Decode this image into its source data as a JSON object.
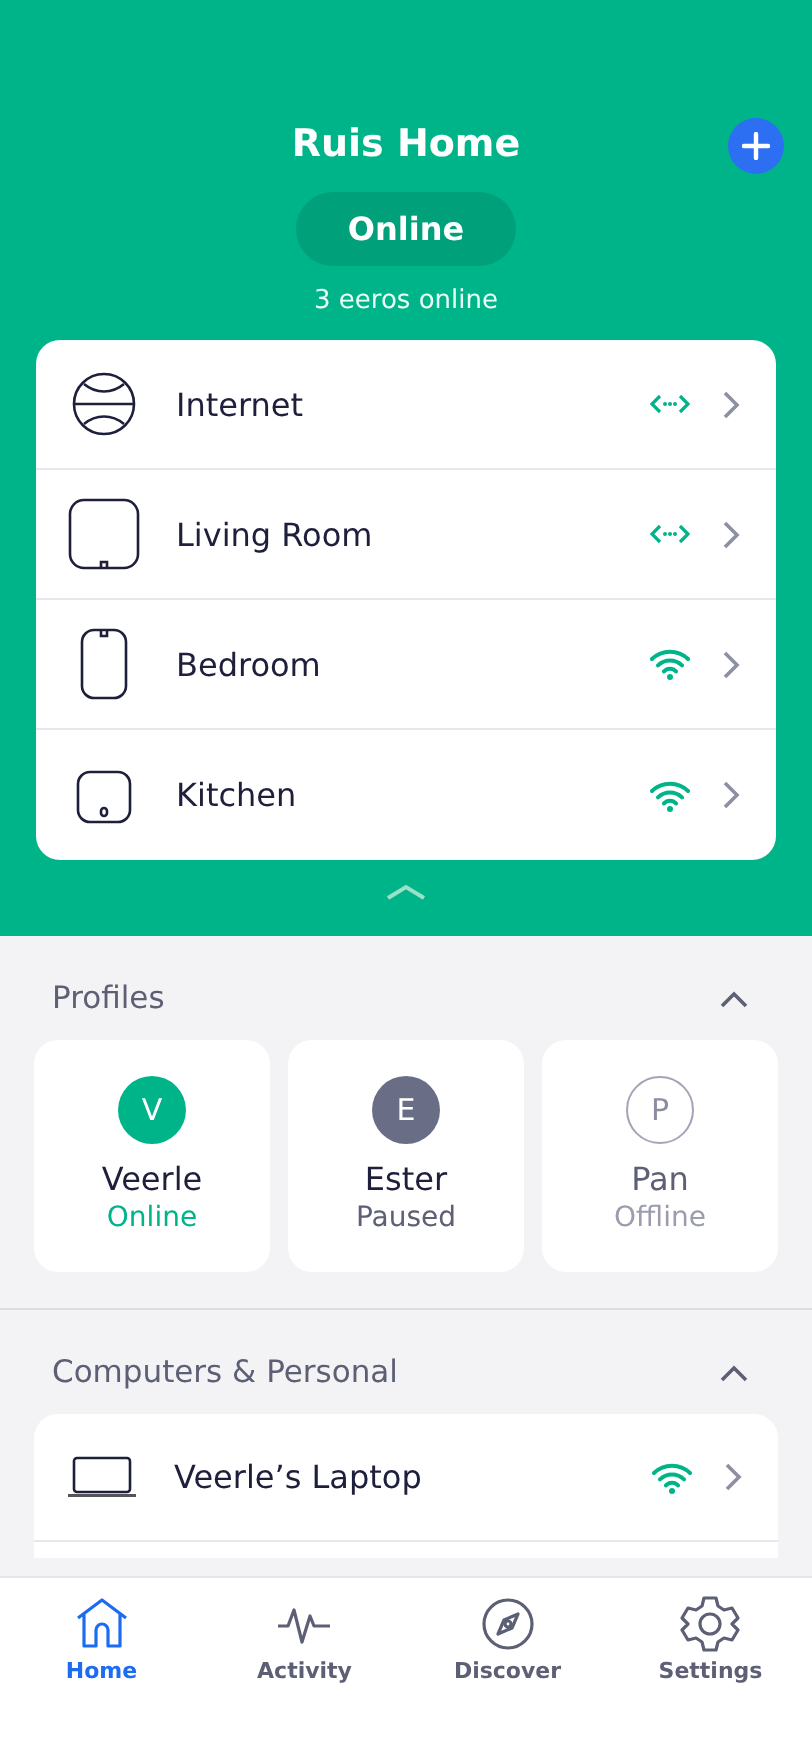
{
  "header": {
    "title": "Ruis Home",
    "status_pill": "Online",
    "subtitle": "3 eeros online"
  },
  "devices": [
    {
      "name": "Internet",
      "kind": "globe",
      "wireless": false
    },
    {
      "name": "Living Room",
      "kind": "base",
      "wireless": false
    },
    {
      "name": "Bedroom",
      "kind": "tall",
      "wireless": true
    },
    {
      "name": "Kitchen",
      "kind": "small",
      "wireless": true
    }
  ],
  "profiles": {
    "title": "Profiles",
    "items": [
      {
        "initial": "V",
        "name": "Veerle",
        "status": "Online",
        "kind": "online"
      },
      {
        "initial": "E",
        "name": "Ester",
        "status": "Paused",
        "kind": "paused"
      },
      {
        "initial": "P",
        "name": "Pan",
        "status": "Offline",
        "kind": "offline"
      }
    ]
  },
  "computers": {
    "title": "Computers & Personal",
    "items": [
      {
        "name": "Veerle’s Laptop",
        "kind": "laptop",
        "wireless": true
      }
    ]
  },
  "tabs": [
    {
      "label": "Home",
      "kind": "home",
      "selected": true
    },
    {
      "label": "Activity",
      "kind": "activity",
      "selected": false
    },
    {
      "label": "Discover",
      "kind": "discover",
      "selected": false
    },
    {
      "label": "Settings",
      "kind": "settings",
      "selected": false
    }
  ]
}
